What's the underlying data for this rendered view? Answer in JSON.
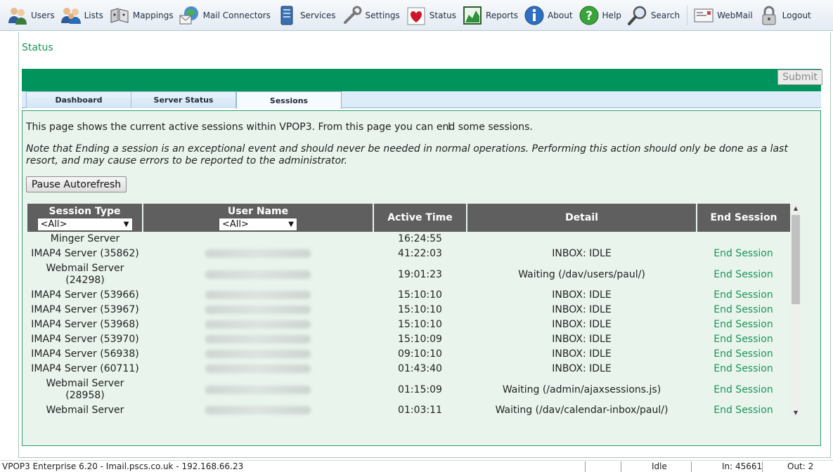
{
  "toolbar": {
    "items": [
      {
        "label": "Users",
        "icon": "users-icon"
      },
      {
        "label": "Lists",
        "icon": "lists-icon"
      },
      {
        "label": "Mappings",
        "icon": "mappings-icon"
      },
      {
        "label": "Mail Connectors",
        "icon": "mail-connectors-icon"
      },
      {
        "label": "Services",
        "icon": "services-icon"
      },
      {
        "label": "Settings",
        "icon": "settings-icon"
      },
      {
        "label": "Status",
        "icon": "status-heart-icon"
      },
      {
        "label": "Reports",
        "icon": "reports-icon"
      },
      {
        "label": "About",
        "icon": "about-info-icon"
      },
      {
        "label": "Help",
        "icon": "help-icon"
      },
      {
        "label": "Search",
        "icon": "search-icon"
      },
      {
        "label": "WebMail",
        "icon": "webmail-icon"
      },
      {
        "label": "Logout",
        "icon": "logout-padlock-icon"
      }
    ]
  },
  "page": {
    "title": "Status",
    "submit_label": "Submit",
    "tabs": [
      {
        "label": "Dashboard"
      },
      {
        "label": "Server Status"
      },
      {
        "label": "Sessions"
      }
    ],
    "active_tab": "Sessions",
    "intro": "This page shows the current active sessions within VPOP3. From this page you can end some sessions.",
    "note": "Note that Ending a session is an exceptional event and should never be needed in normal operations. Performing this action should only be done as a last resort, and may cause errors to be reported to the administrator.",
    "pause_label": "Pause Autorefresh"
  },
  "table": {
    "headers": {
      "session_type": "Session Type",
      "user_name": "User Name",
      "active_time": "Active Time",
      "detail": "Detail",
      "end_session": "End Session"
    },
    "filters": {
      "session_type": "<All>",
      "user_name": "<All>"
    },
    "end_label": "End Session",
    "rows": [
      {
        "type": "Minger Server",
        "time": "16:24:55",
        "detail": "",
        "end": ""
      },
      {
        "type": "IMAP4 Server (35862)",
        "time": "41:22:03",
        "detail": "INBOX: IDLE",
        "end": "End Session"
      },
      {
        "type": "Webmail Server (24298)",
        "time": "19:01:23",
        "detail": "Waiting (/dav/users/paul/)",
        "end": "End Session"
      },
      {
        "type": "IMAP4 Server (53966)",
        "time": "15:10:10",
        "detail": "INBOX: IDLE",
        "end": "End Session"
      },
      {
        "type": "IMAP4 Server (53967)",
        "time": "15:10:10",
        "detail": "INBOX: IDLE",
        "end": "End Session"
      },
      {
        "type": "IMAP4 Server (53968)",
        "time": "15:10:10",
        "detail": "INBOX: IDLE",
        "end": "End Session"
      },
      {
        "type": "IMAP4 Server (53970)",
        "time": "15:10:09",
        "detail": "INBOX: IDLE",
        "end": "End Session"
      },
      {
        "type": "IMAP4 Server (56938)",
        "time": "09:10:10",
        "detail": "INBOX: IDLE",
        "end": "End Session"
      },
      {
        "type": "IMAP4 Server (60711)",
        "time": "01:43:40",
        "detail": "INBOX: IDLE",
        "end": "End Session"
      },
      {
        "type": "Webmail Server (28958)",
        "time": "01:15:09",
        "detail": "Waiting (/admin/ajaxsessions.js)",
        "end": "End Session"
      },
      {
        "type": "Webmail Server",
        "time": "01:03:11",
        "detail": "Waiting (/dav/calendar-inbox/paul/)",
        "end": "End Session"
      }
    ]
  },
  "statusbar": {
    "server": "VPOP3 Enterprise 6.20 - Imail.pscs.co.uk - 192.168.66.23",
    "state": "Idle",
    "in": "In: 45661",
    "out": "Out: 2"
  },
  "colors": {
    "accent_green": "#00945c",
    "link_green": "#1e9457",
    "header_grey": "#5f5f5f",
    "content_bg": "#e8f4ec"
  }
}
